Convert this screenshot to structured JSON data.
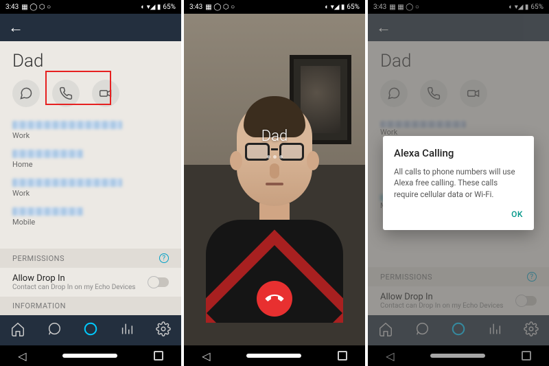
{
  "status": {
    "time": "3:43",
    "battery": "65%"
  },
  "screen1": {
    "contact_name": "Dad",
    "phones": [
      {
        "label": "Work"
      },
      {
        "label": "Home"
      },
      {
        "label": "Work"
      },
      {
        "label": "Mobile"
      }
    ],
    "permissions_header": "PERMISSIONS",
    "drop_in_title": "Allow Drop In",
    "drop_in_sub": "Contact can Drop In on my Echo Devices",
    "information_header": "INFORMATION"
  },
  "screen2": {
    "caller_name": "Dad"
  },
  "screen3": {
    "contact_name": "Dad",
    "phones": [
      {
        "label": "Work"
      },
      {
        "label": "Mobile"
      }
    ],
    "permissions_header": "PERMISSIONS",
    "drop_in_title": "Allow Drop In",
    "drop_in_sub": "Contact can Drop In on my Echo Devices",
    "dialog_title": "Alexa Calling",
    "dialog_body": "All calls to phone numbers will use Alexa free calling. These calls require cellular data or Wi-Fi.",
    "dialog_ok": "OK"
  }
}
